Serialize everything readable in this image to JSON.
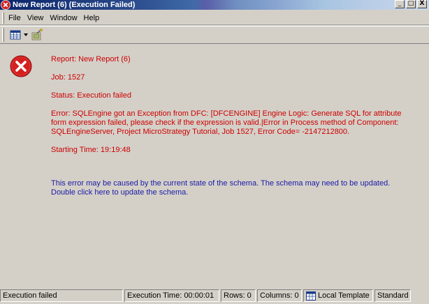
{
  "window": {
    "title": "New Report (6) (Execution Failed)",
    "buttons": {
      "minimize": "_",
      "maximize": "□",
      "close": "X"
    }
  },
  "menu": {
    "items": [
      "File",
      "View",
      "Window",
      "Help"
    ]
  },
  "toolbar": {
    "grid_icon": "grid-view-icon",
    "dropdown_icon": "dropdown-arrow-icon",
    "wizard_icon": "wizard-icon"
  },
  "report": {
    "name": "Report: New Report (6)",
    "job": "Job: 1527",
    "status": "Status: Execution failed",
    "error": "Error: SQLEngine got an Exception from DFC: [DFCENGINE] Engine Logic: Generate SQL for attribute form expression failed, please check if the expression is valid.|Error in Process method of Component: SQLEngineServer, Project MicroStrategy Tutorial, Job 1527, Error Code= -2147212800.",
    "starting_time": "Starting Time: 19:19:48",
    "hint": "This error may be caused by the current state of the schema. The schema may need to be updated. Double click here to update the schema."
  },
  "statusbar": {
    "state": "Execution failed",
    "execution_time": "Execution Time: 00:00:01",
    "rows": "Rows: 0",
    "columns": "Columns: 0",
    "template": "Local Template",
    "view": "Standard"
  },
  "colors": {
    "error_text": "#cc0000",
    "hint_text": "#1a1aa6",
    "error_icon": "#d42020"
  }
}
